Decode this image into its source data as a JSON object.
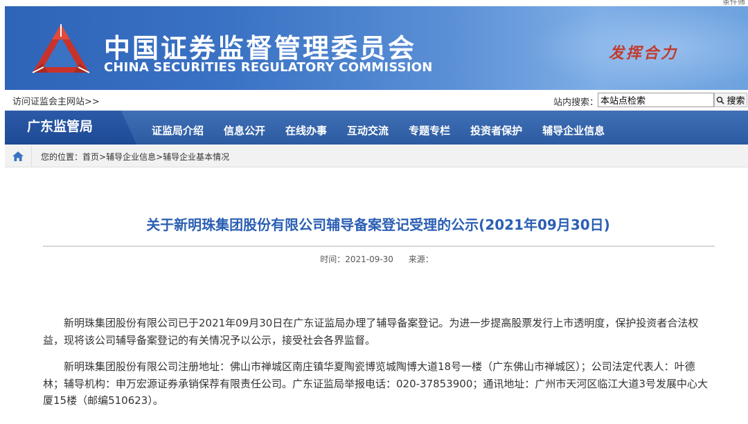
{
  "window": {
    "top_right_text": "条件筛"
  },
  "header": {
    "title_cn": "中国证券监督管理委员会",
    "title_en": "CHINA SECURITIES REGULATORY COMMISSION",
    "slogan": "发挥合力"
  },
  "subbar": {
    "visit_link": "访问证监会主网站>>",
    "search_label": "站内搜索：",
    "search_value": "本站点检索",
    "search_button": "搜索"
  },
  "nav": {
    "dept": "广东监管局",
    "items": [
      "证监局介绍",
      "信息公开",
      "在线办事",
      "互动交流",
      "专题专栏",
      "投资者保护",
      "辅导企业信息"
    ]
  },
  "breadcrumb": {
    "prefix": "您的位置：",
    "home": "首页",
    "sep1": ">",
    "level1": "辅导企业信息",
    "sep2": ">",
    "level2": "辅导企业基本情况"
  },
  "article": {
    "title": "关于新明珠集团股份有限公司辅导备案登记受理的公示(2021年09月30日)",
    "time_label": "时间：2021-09-30",
    "source_label": "来源：",
    "paragraphs": [
      "新明珠集团股份有限公司已于2021年09月30日在广东证监局办理了辅导备案登记。为进一步提高股票发行上市透明度，保护投资者合法权益，现将该公司辅导备案登记的有关情况予以公示，接受社会各界监督。",
      "新明珠集团股份有限公司注册地址：佛山市禅城区南庄镇华夏陶瓷博览城陶博大道18号一楼（广东佛山市禅城区）；公司法定代表人：叶德林；辅导机构：申万宏源证券承销保荐有限责任公司。广东证监局举报电话：020-37853900；通讯地址：广州市天河区临江大道3号发展中心大厦15楼（邮编510623）。"
    ]
  },
  "colors": {
    "banner": "#3a72c4",
    "nav": "#2c5ba1",
    "title": "#2b5fb3",
    "slogan": "#c23b2e",
    "logo": "#c8322a"
  }
}
